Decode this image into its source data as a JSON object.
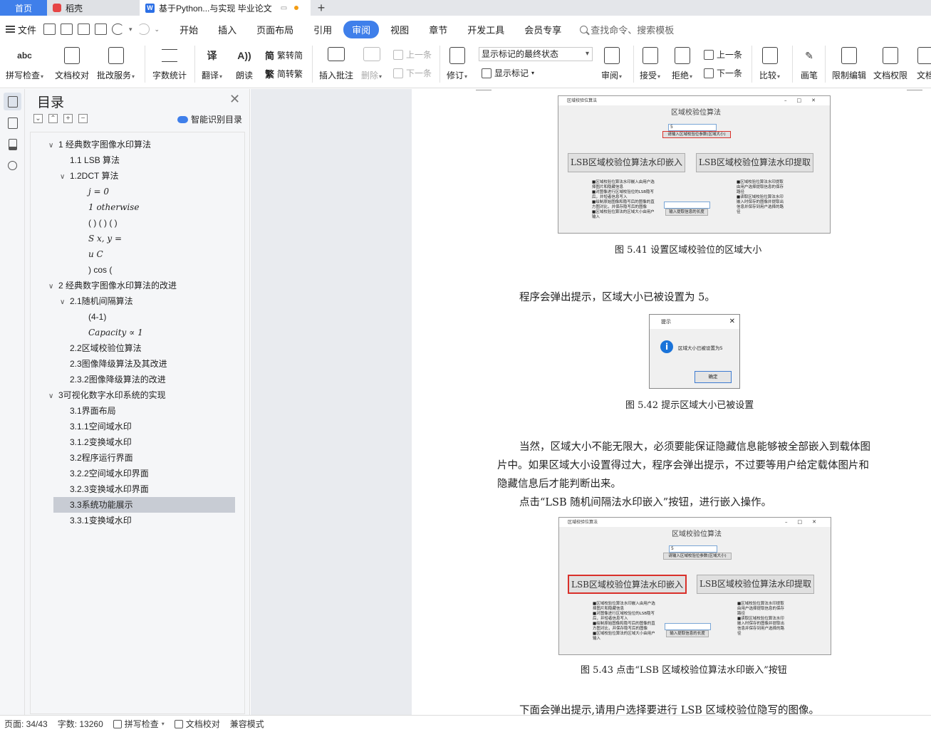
{
  "tabs": {
    "home": "首页",
    "straw": "稻壳",
    "doc": "基于Python...与实现 毕业论文"
  },
  "menu": {
    "file": "文件",
    "tabs": [
      "开始",
      "插入",
      "页面布局",
      "引用",
      "审阅",
      "视图",
      "章节",
      "开发工具",
      "会员专享"
    ],
    "active": "审阅",
    "search": "查找命令、搜索模板"
  },
  "ribbon": {
    "spell": "拼写检查",
    "proof": "文档校对",
    "correct": "批改服务",
    "wordcount": "字数统计",
    "translate": "翻译",
    "read": "朗读",
    "trad": "繁转简",
    "simp": "简转繁",
    "insert_comment": "插入批注",
    "delete": "删除",
    "prev": "上一条",
    "next": "下一条",
    "revise": "修订",
    "markup_state": "显示标记的最终状态",
    "show_markup": "显示标记",
    "review": "审阅",
    "accept": "接受",
    "reject": "拒绝",
    "prev2": "上一条",
    "next2": "下一条",
    "compare": "比较",
    "pen": "画笔",
    "restrict": "限制编辑",
    "doc_perm": "文档权限",
    "doc_more": "文档"
  },
  "toc": {
    "title": "目录",
    "smart": "智能识别目录",
    "items": [
      {
        "text": "1 经典数字图像水印算法",
        "level": 0,
        "arrow": "⌄"
      },
      {
        "text": "1.1 LSB 算法",
        "level": 1,
        "arrow": ""
      },
      {
        "text": "1.2DCT 算法",
        "level": 1,
        "arrow": "⌄"
      },
      {
        "text": "j = 0",
        "level": 2,
        "arrow": ""
      },
      {
        "text": "1 otherwise",
        "level": 2,
        "arrow": ""
      },
      {
        "text": "( ) ( ) ( )",
        "level": 2,
        "arrow": ""
      },
      {
        "text": "S x, y =",
        "level": 2,
        "arrow": ""
      },
      {
        "text": "u C",
        "level": 2,
        "arrow": ""
      },
      {
        "text": ") cos (",
        "level": 2,
        "arrow": ""
      },
      {
        "text": "2 经典数字图像水印算法的改进",
        "level": 0,
        "arrow": "⌄"
      },
      {
        "text": "2.1随机间隔算法",
        "level": 1,
        "arrow": "⌄"
      },
      {
        "text": "(4-1)",
        "level": 2,
        "arrow": ""
      },
      {
        "text": "Capacity ∝ 1",
        "level": 2,
        "arrow": ""
      },
      {
        "text": "2.2区域校验位算法",
        "level": 1,
        "arrow": ""
      },
      {
        "text": "2.3图像降级算法及其改进",
        "level": 1,
        "arrow": ""
      },
      {
        "text": "2.3.2图像降级算法的改进",
        "level": 1,
        "arrow": ""
      },
      {
        "text": "3可视化数字水印系统的实现",
        "level": 0,
        "arrow": "⌄"
      },
      {
        "text": "3.1界面布局",
        "level": 1,
        "arrow": ""
      },
      {
        "text": "3.1.1空间域水印",
        "level": 1,
        "arrow": ""
      },
      {
        "text": "3.1.2变换域水印",
        "level": 1,
        "arrow": ""
      },
      {
        "text": "3.2程序运行界面",
        "level": 1,
        "arrow": ""
      },
      {
        "text": "3.2.2空间域水印界面",
        "level": 1,
        "arrow": ""
      },
      {
        "text": "3.2.3变换域水印界面",
        "level": 1,
        "arrow": ""
      },
      {
        "text": "3.3系统功能展示",
        "level": 1,
        "arrow": "",
        "selected": true
      },
      {
        "text": "3.3.1变换域水印",
        "level": 1,
        "arrow": ""
      }
    ]
  },
  "doc": {
    "fig41": {
      "window_title": "区域校验位算法",
      "heading": "区域校验位算法",
      "input_value": "5",
      "input_button": "请输入区域校验位参数(区域大小)",
      "embed": "LSB区域校验位算法水印嵌入",
      "extract": "LSB区域校验位算法水印提取",
      "left_notes": "■区域校验位算法水印嵌入由用户选择图片和隐藏信息\n■对图像进行区域校验位的LSB隐写后，并短者信息写入\n■绘制原始图像和隐写后的图像的直方图对比，并保存隐写后的图像\n■区域校验位算法的区域大小由用户输入",
      "right_notes": "■区域校验位算法水印提取由用户选择提取信息的保存路径\n■读取区域校验位算法水印嵌入时保存的图像并提取出信息并保存到用户选择的路径",
      "extract_len": "输入提取信息的长度",
      "caption": "图 5.41   设置区域校验位的区域大小"
    },
    "para1": "程序会弹出提示，区域大小已被设置为  5。",
    "fig42": {
      "title": "提示",
      "message": "区域大小已被设置为5",
      "ok": "确定",
      "caption": "图 5.42   提示区域大小已被设置"
    },
    "para2": [
      "当然，区域大小不能无限大，必须要能保证隐藏信息能够被全部嵌入到载体图",
      "片中。如果区域大小设置得过大，程序会弹出提示，不过要等用户给定载体图片和",
      "隐藏信息后才能判断出来。",
      "点击“LSB 随机间隔法水印嵌入”按钮，进行嵌入操作。"
    ],
    "fig43": {
      "caption": "图 5.43   点击“LSB 区域校验位算法水印嵌入”按钮"
    },
    "para3": "下面会弹出提示,请用户选择要进行  LSB 区域校验位隐写的图像。"
  },
  "status": {
    "page": "页面: 34/43",
    "words": "字数: 13260",
    "spell": "拼写检查",
    "proof": "文档校对",
    "compat": "兼容模式"
  }
}
